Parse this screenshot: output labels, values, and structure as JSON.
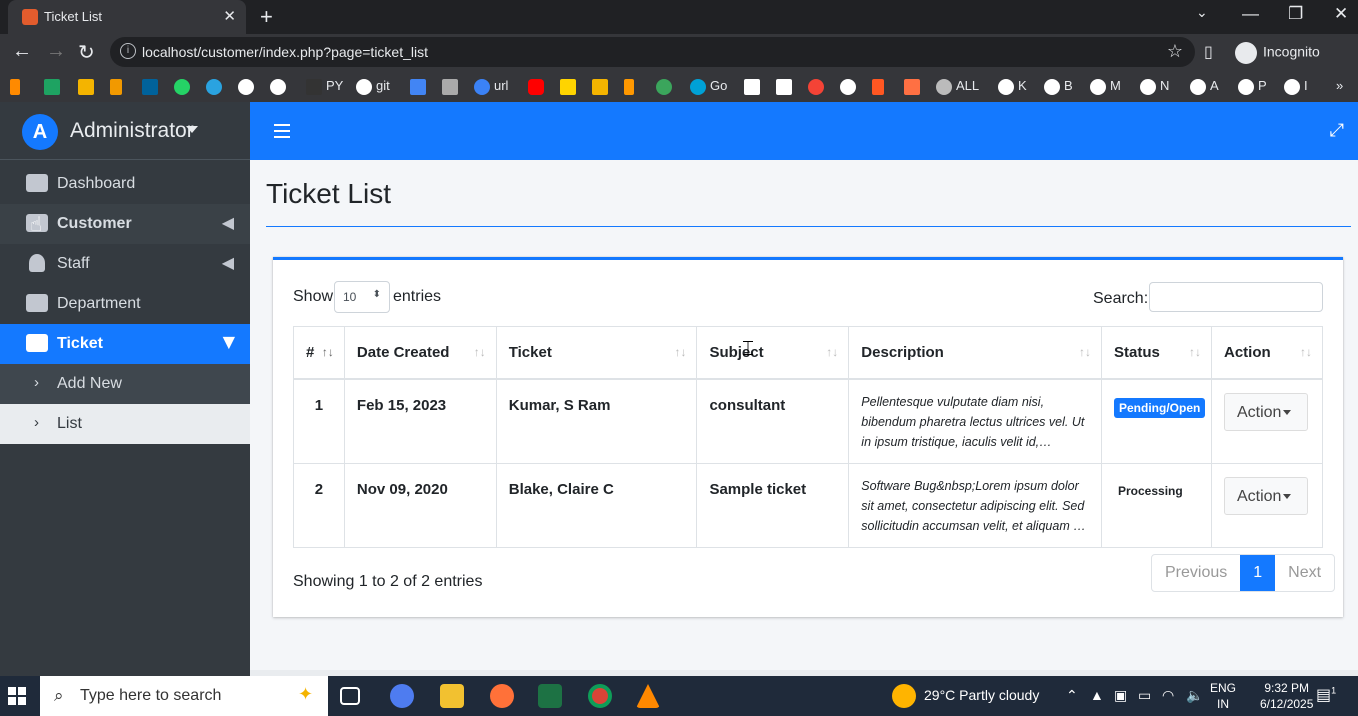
{
  "browser": {
    "tab_title": "Ticket List",
    "url": "localhost/customer/index.php?page=ticket_list",
    "profile_label": "Incognito",
    "bookmarks": [
      "PY",
      "git",
      "url",
      "Go",
      "ALL",
      "K",
      "B",
      "M",
      "N",
      "A",
      "P",
      "I"
    ]
  },
  "sidebar": {
    "brand_initial": "A",
    "brand_name": "Administrator",
    "items": [
      {
        "label": "Dashboard"
      },
      {
        "label": "Customer"
      },
      {
        "label": "Staff"
      },
      {
        "label": "Department"
      },
      {
        "label": "Ticket"
      },
      {
        "label": "Add New"
      },
      {
        "label": "List"
      }
    ]
  },
  "page": {
    "title": "Ticket List"
  },
  "table_controls": {
    "show_label": "Show",
    "entries_value": "10",
    "entries_label": "entries",
    "search_label": "Search:",
    "search_value": ""
  },
  "table": {
    "columns": [
      "#",
      "Date Created",
      "Ticket",
      "Subject",
      "Description",
      "Status",
      "Action"
    ],
    "rows": [
      {
        "num": "1",
        "date": "Feb 15, 2023",
        "ticket": "Kumar, S Ram",
        "subject": "consultant",
        "description": "Pellentesque vulputate diam nisi, bibendum pharetra lectus ultrices vel. Ut in ipsum tristique, iaculis velit id,…",
        "status": "Pending/Open",
        "action": "Action"
      },
      {
        "num": "2",
        "date": "Nov 09, 2020",
        "ticket": "Blake, Claire C",
        "subject": "Sample ticket",
        "description": "Software Bug&nbsp;Lorem ipsum dolor sit amet, consectetur adipiscing elit. Sed sollicitudin accumsan velit, et aliquam …",
        "status": "Processing",
        "action": "Action"
      }
    ]
  },
  "footer": {
    "showing_text": "Showing 1 to 2 of 2 entries",
    "prev_label": "Previous",
    "page_label": "1",
    "next_label": "Next"
  },
  "taskbar": {
    "search_placeholder": "Type here to search",
    "weather": "29°C  Partly cloudy",
    "lang_line1": "ENG",
    "lang_line2": "IN",
    "time": "9:32 PM",
    "date": "6/12/2025",
    "notification_count": "1"
  },
  "colors": {
    "primary": "#1479ff",
    "sidebar_bg": "#343a40"
  }
}
